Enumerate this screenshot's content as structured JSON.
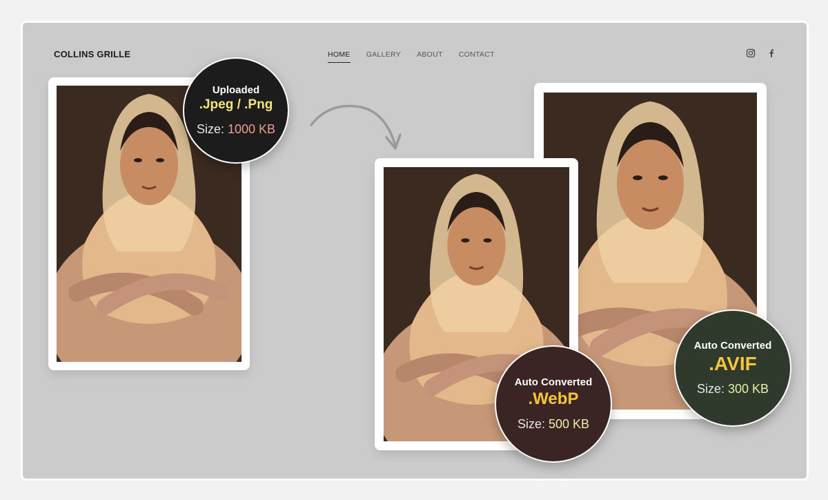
{
  "header": {
    "brand": "COLLINS GRILLE",
    "nav": [
      "HOME",
      "GALLERY",
      "ABOUT",
      "CONTACT"
    ],
    "social_icons": [
      "instagram-icon",
      "facebook-icon"
    ]
  },
  "badges": {
    "uploaded": {
      "label": "Uploaded",
      "format": ".Jpeg / .Png",
      "size_label": "Size:",
      "size_value": "1000 KB",
      "bg_color": "#1c1c1c",
      "format_color": "#f3e47c",
      "size_color": "#f19a91"
    },
    "webp": {
      "label": "Auto Converted",
      "format": ".WebP",
      "size_label": "Size:",
      "size_value": "500 KB",
      "bg_color": "#3b2524",
      "format_color": "#f6c53a",
      "size_color": "#e9f0a8"
    },
    "avif": {
      "label": "Auto Converted",
      "format": ".AVIF",
      "size_label": "Size:",
      "size_value": "300 KB",
      "bg_color": "#2f3a2c",
      "format_color": "#f6c53a",
      "size_color": "#e9f0a8"
    }
  }
}
